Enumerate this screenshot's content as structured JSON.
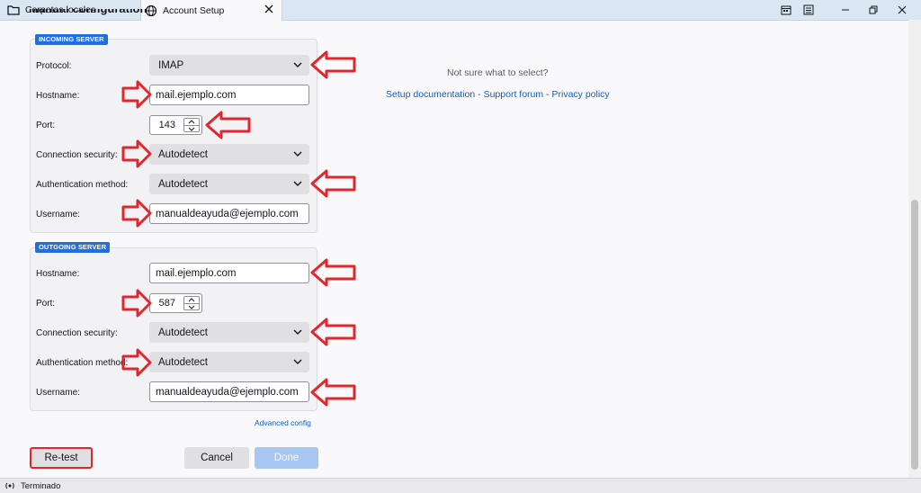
{
  "tabs": [
    {
      "label": "Carpetas locales",
      "icon": "folder-icon"
    },
    {
      "label": "Account Setup",
      "icon": "globe-icon",
      "active": true
    }
  ],
  "page": {
    "title": "Manual configuration"
  },
  "incoming": {
    "badge": "INCOMING SERVER",
    "protocol": {
      "label": "Protocol:",
      "value": "IMAP"
    },
    "hostname": {
      "label": "Hostname:",
      "value": "mail.ejemplo.com"
    },
    "port": {
      "label": "Port:",
      "value": "143"
    },
    "security": {
      "label": "Connection security:",
      "value": "Autodetect"
    },
    "auth": {
      "label": "Authentication method:",
      "value": "Autodetect"
    },
    "username": {
      "label": "Username:",
      "value": "manualdeayuda@ejemplo.com"
    }
  },
  "outgoing": {
    "badge": "OUTGOING SERVER",
    "hostname": {
      "label": "Hostname:",
      "value": "mail.ejemplo.com"
    },
    "port": {
      "label": "Port:",
      "value": "587"
    },
    "security": {
      "label": "Connection security:",
      "value": "Autodetect"
    },
    "auth": {
      "label": "Authentication method:",
      "value": "Autodetect"
    },
    "username": {
      "label": "Username:",
      "value": "manualdeayuda@ejemplo.com"
    }
  },
  "help": {
    "question": "Not sure what to select?",
    "links": [
      "Setup documentation",
      "Support forum",
      "Privacy policy"
    ],
    "separator": " - "
  },
  "advanced_link": "Advanced config",
  "buttons": {
    "retest": "Re-test",
    "cancel": "Cancel",
    "done": "Done"
  },
  "status": {
    "text": "Terminado"
  },
  "colors": {
    "accent": "#1f6fe0",
    "annotation_red": "#e0272e",
    "link": "#0b5ecb"
  }
}
